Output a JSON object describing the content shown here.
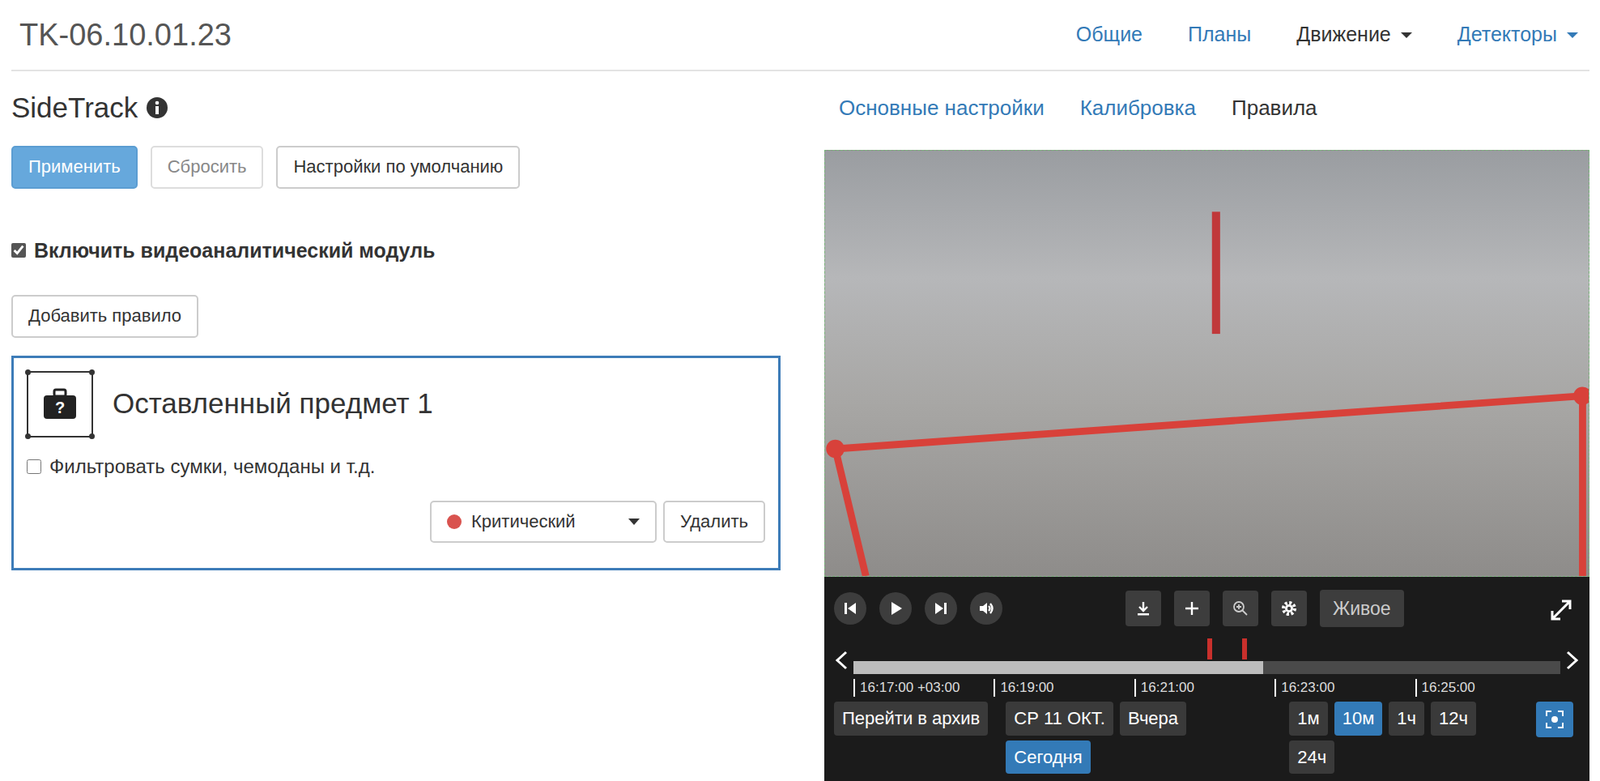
{
  "header": {
    "title": "TK-06.10.01.23",
    "nav": [
      {
        "label": "Общие",
        "selected": false,
        "dropdown": false
      },
      {
        "label": "Планы",
        "selected": false,
        "dropdown": false
      },
      {
        "label": "Движение",
        "selected": true,
        "dropdown": true
      },
      {
        "label": "Детекторы",
        "selected": false,
        "dropdown": true
      }
    ]
  },
  "module": {
    "title": "SideTrack",
    "buttons": [
      {
        "label": "Применить",
        "kind": "primary",
        "disabled": false
      },
      {
        "label": "Сбросить",
        "kind": "plain",
        "disabled": true
      },
      {
        "label": "Настройки по умолчанию",
        "kind": "plain",
        "disabled": false
      }
    ],
    "enable": {
      "label": "Включить видеоаналитический модуль",
      "checked": true
    },
    "add_rule": "Добавить правило",
    "rules": [
      {
        "title": "Оставленный предмет 1",
        "icon_text": "?",
        "selected": true,
        "filter": {
          "label": "Фильтровать сумки, чемоданы и т.д.",
          "checked": false
        },
        "severity": {
          "label": "Критический",
          "color": "#d9534f"
        },
        "delete": "Удалить"
      }
    ]
  },
  "tabs": [
    {
      "label": "Основные настройки",
      "selected": false
    },
    {
      "label": "Калибровка",
      "selected": false
    },
    {
      "label": "Правила",
      "selected": true
    }
  ],
  "player": {
    "live": "Живое",
    "timeline": {
      "level": 0.58,
      "markers": [
        0.5,
        0.55
      ],
      "ticks": [
        "16:17:00 +03:00",
        "16:19:00",
        "16:21:00",
        "16:23:00",
        "16:25:00"
      ]
    },
    "archive": "Перейти в архив",
    "days": [
      {
        "label": "СР 11 ОКТ.",
        "selected": false
      },
      {
        "label": "Вчера",
        "selected": false
      },
      {
        "label": "Сегодня",
        "selected": true
      }
    ],
    "ranges": [
      {
        "label": "1м",
        "selected": false
      },
      {
        "label": "10м",
        "selected": true
      },
      {
        "label": "1ч",
        "selected": false
      },
      {
        "label": "12ч",
        "selected": false
      },
      {
        "label": "24ч",
        "selected": false
      }
    ],
    "fit_selected": true
  }
}
